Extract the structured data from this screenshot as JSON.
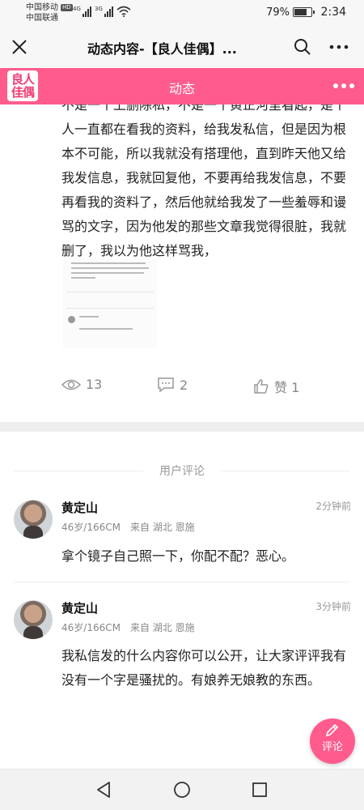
{
  "status_bar": {
    "carrier1": "中国移动",
    "carrier1_badge": "HD",
    "carrier2": "中国联通",
    "signal1_label": "4G",
    "signal2_label": "3G",
    "battery_percent": "79%",
    "battery_level": 0.79,
    "time": "2:34"
  },
  "title_bar": {
    "title": "动态内容-【良人佳偶】...",
    "icons": [
      "close-icon",
      "search-icon",
      "more-icon"
    ]
  },
  "app_header": {
    "logo_text": "良人佳偶",
    "title": "动态",
    "icons": [
      "more-icon"
    ]
  },
  "post": {
    "text": "不是一个上删除私，不是一个黄正河里看起，是个人一直都在看我的资料，给我发私信，但是因为根本不可能，所以我就没有搭理他，直到昨天他又给我发信息，我就回复他，不要再给我发信息，不要再看我的资料了，然后他就给我发了一些羞辱和谩骂的文字，因为他发的那些文章我觉得很脏，我就删了，我以为他这样骂我，",
    "views": "13",
    "comments": "2",
    "likes": "赞 1"
  },
  "comments": {
    "header": "用户评论",
    "items": [
      {
        "name": "黄定山",
        "time": "2分钟前",
        "age_height": "46岁/166CM",
        "from": "来自 湖北 恩施",
        "text": "拿个镜子自己照一下，你配不配？恶心。"
      },
      {
        "name": "黄定山",
        "time": "3分钟前",
        "age_height": "46岁/166CM",
        "from": "来自 湖北 恩施",
        "text": "我私信发的什么内容你可以公开，让大家评评我有没有一个字是骚扰的。有娘养无娘教的东西。"
      }
    ]
  },
  "fab": {
    "label": "评论",
    "color": "#ff5c8d"
  },
  "nav_bar": {
    "icons": [
      "back-icon",
      "home-icon",
      "recents-icon"
    ]
  },
  "colors": {
    "accent": "#ff5c8d"
  }
}
